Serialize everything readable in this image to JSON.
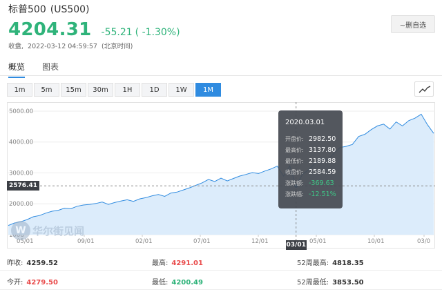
{
  "header": {
    "name": "标普500",
    "code": "(US500)",
    "price": "4204.31",
    "change": "-55.21",
    "change_pct": "( -1.30%)",
    "status": "收盘,",
    "timestamp": "2022-03-12 04:59:57",
    "timezone": "(北京时间)",
    "fav_label": "~删自选"
  },
  "tabs": [
    {
      "label": "概览",
      "active": true
    },
    {
      "label": "图表",
      "active": false
    }
  ],
  "ranges": [
    "1m",
    "5m",
    "15m",
    "30m",
    "1H",
    "1D",
    "1W",
    "1M"
  ],
  "active_range": "1M",
  "chart_type_icon": "line-chart-icon",
  "tooltip": {
    "date": "2020.03.01",
    "rows": [
      {
        "label": "开盘价:",
        "value": "2982.50"
      },
      {
        "label": "最高价:",
        "value": "3137.80"
      },
      {
        "label": "最低价:",
        "value": "2189.88"
      },
      {
        "label": "收盘价:",
        "value": "2584.59"
      },
      {
        "label": "涨跌额:",
        "value": "-369.63"
      },
      {
        "label": "涨跌幅:",
        "value": "-12.51%"
      }
    ]
  },
  "crosshair": {
    "y_label": "2576.41",
    "x_label": "03/01"
  },
  "watermark": {
    "logo": "W",
    "text": "华尔街见闻"
  },
  "stats": [
    [
      {
        "label": "昨收:",
        "value": "4259.52",
        "tone": "neutral"
      },
      {
        "label": "最高:",
        "value": "4291.01",
        "tone": "up"
      },
      {
        "label": "52周最高:",
        "value": "4818.35",
        "tone": "neutral"
      }
    ],
    [
      {
        "label": "今开:",
        "value": "4279.50",
        "tone": "up"
      },
      {
        "label": "最低:",
        "value": "4200.49",
        "tone": "down"
      },
      {
        "label": "52周最低:",
        "value": "3853.50",
        "tone": "neutral"
      }
    ]
  ],
  "colors": {
    "up": "#e94b4b",
    "down": "#2fb37a",
    "accent": "#2f8be0",
    "line": "#2f8be0",
    "area": "#dcecfb"
  },
  "chart_data": {
    "type": "area",
    "ylim": [
      1000,
      5200
    ],
    "y_ticks": [
      "1000",
      "2000.00",
      "3000.00",
      "4000.00",
      "5000.00"
    ],
    "x_ticks": [
      "05/01",
      "09/01",
      "02/01",
      "07/01",
      "12/01",
      "05/01",
      "10/01",
      "03/0"
    ],
    "series": [
      {
        "values": [
          1300,
          1380,
          1420,
          1490,
          1580,
          1620,
          1700,
          1760,
          1790,
          1860,
          1840,
          1920,
          1960,
          1980,
          2010,
          2060,
          1980,
          2040,
          2090,
          2130,
          2080,
          2160,
          2200,
          2260,
          2300,
          2240,
          2350,
          2380,
          2450,
          2520,
          2600,
          2680,
          2790,
          2720,
          2830,
          2740,
          2820,
          2900,
          2950,
          3010,
          2980,
          3060,
          3130,
          3220,
          2900,
          3230,
          2580,
          2950,
          3100,
          3300,
          3480,
          3420,
          3620,
          3820,
          3860,
          3920,
          4180,
          4250,
          4400,
          4520,
          4580,
          4420,
          4650,
          4520,
          4690,
          4770,
          4900,
          4560,
          4280
        ]
      }
    ],
    "highlight_index": 46
  }
}
